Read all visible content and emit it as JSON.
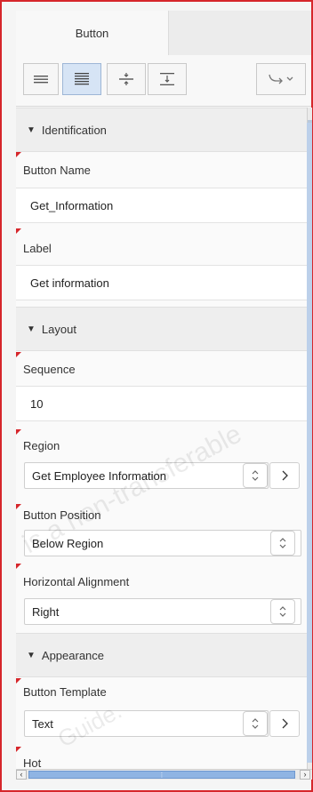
{
  "tab": {
    "label": "Button"
  },
  "toolbar": {
    "buttons": [
      {
        "name": "align-lines-button",
        "active": false
      },
      {
        "name": "align-lines-dense-button",
        "active": true
      },
      {
        "name": "collapse-button",
        "active": false
      },
      {
        "name": "expand-button",
        "active": false
      },
      {
        "name": "goto-dropdown-button",
        "active": false
      }
    ]
  },
  "sections": {
    "identification": {
      "title": "Identification"
    },
    "layout": {
      "title": "Layout"
    },
    "appearance": {
      "title": "Appearance"
    }
  },
  "fields": {
    "button_name": {
      "label": "Button Name",
      "value": "Get_Information"
    },
    "label": {
      "label": "Label",
      "value": "Get information"
    },
    "sequence": {
      "label": "Sequence",
      "value": "10"
    },
    "region": {
      "label": "Region",
      "value": "Get Employee Information"
    },
    "button_position": {
      "label": "Button Position",
      "value": "Below Region"
    },
    "horizontal_alignment": {
      "label": "Horizontal Alignment",
      "value": "Right"
    },
    "button_template": {
      "label": "Button Template",
      "value": "Text"
    },
    "hot": {
      "label": "Hot"
    }
  },
  "watermark": {
    "line1": "is a non-transferable",
    "line2": "Guide."
  },
  "colors": {
    "frame": "#d6262b",
    "active_toolbar": "#d6e4f5",
    "scroll_thumb": "#8fb4e3"
  }
}
